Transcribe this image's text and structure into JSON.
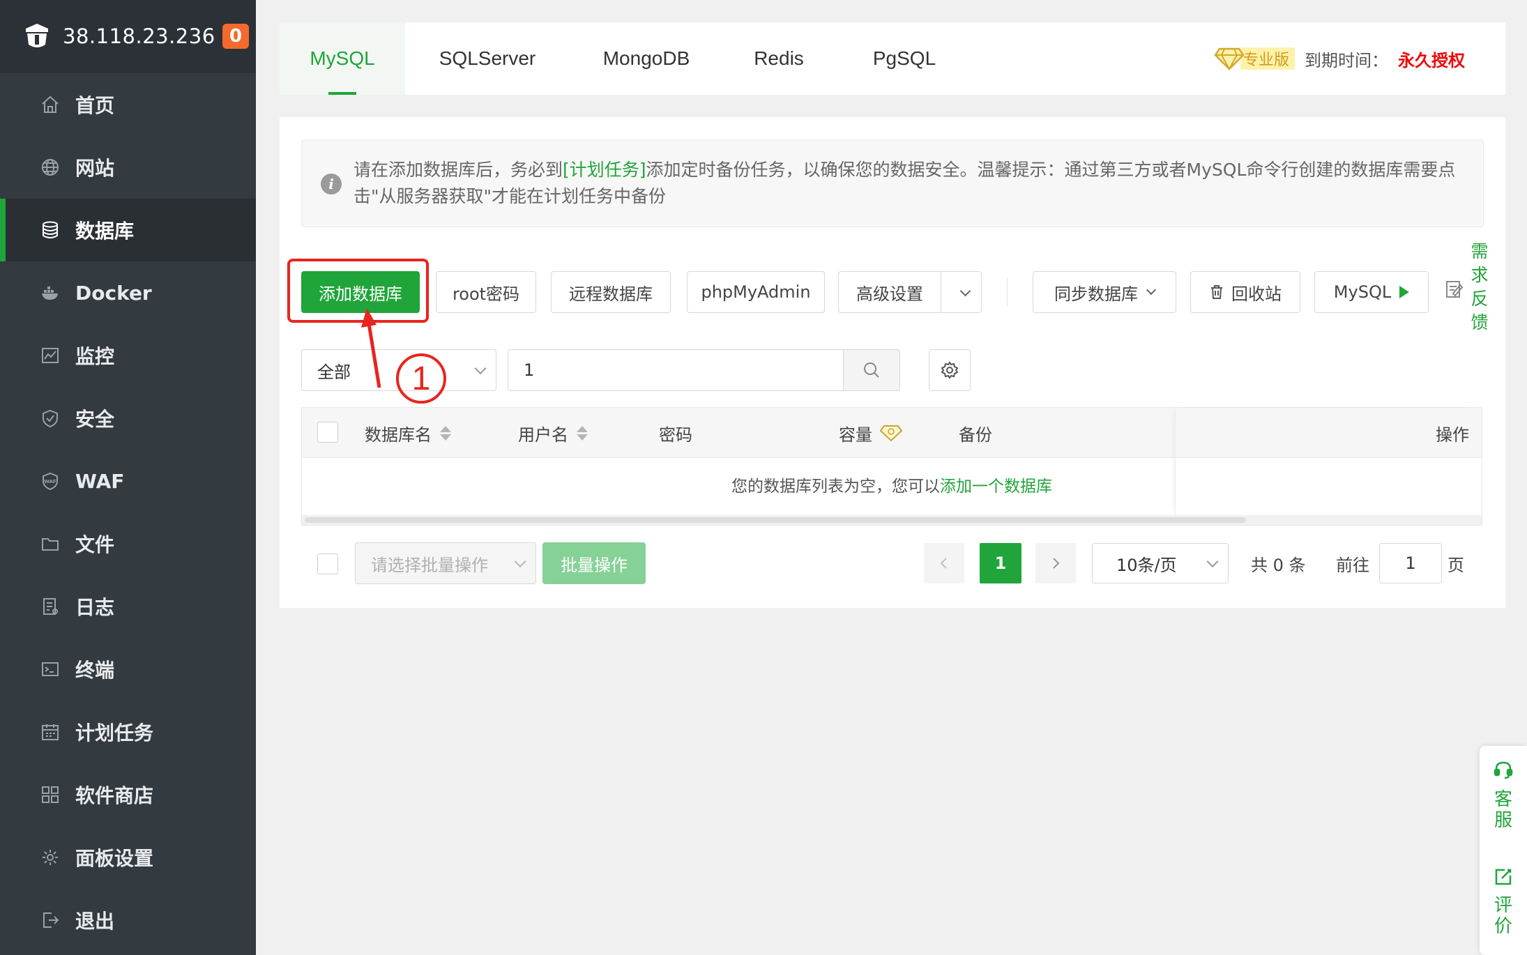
{
  "sidebar": {
    "server_ip": "38.118.23.236",
    "badge_count": "0",
    "items": [
      {
        "label": "首页",
        "icon": "home-icon"
      },
      {
        "label": "网站",
        "icon": "globe-icon"
      },
      {
        "label": "数据库",
        "icon": "database-icon",
        "active": true
      },
      {
        "label": "Docker",
        "icon": "docker-icon"
      },
      {
        "label": "监控",
        "icon": "monitor-icon"
      },
      {
        "label": "安全",
        "icon": "shield-icon"
      },
      {
        "label": "WAF",
        "icon": "waf-shield-icon"
      },
      {
        "label": "文件",
        "icon": "folder-icon"
      },
      {
        "label": "日志",
        "icon": "log-icon"
      },
      {
        "label": "终端",
        "icon": "terminal-icon"
      },
      {
        "label": "计划任务",
        "icon": "calendar-icon"
      },
      {
        "label": "软件商店",
        "icon": "apps-grid-icon"
      },
      {
        "label": "面板设置",
        "icon": "gear-icon"
      },
      {
        "label": "退出",
        "icon": "logout-icon"
      }
    ]
  },
  "tabs": {
    "items": [
      "MySQL",
      "SQLServer",
      "MongoDB",
      "Redis",
      "PgSQL"
    ],
    "active": "MySQL",
    "pro_label": "专业版",
    "expire_label": "到期时间：",
    "expire_value": "永久授权"
  },
  "notice": {
    "text_before": "请在添加数据库后，务必到",
    "link": "[计划任务]",
    "text_after": "添加定时备份任务，以确保您的数据安全。温馨提示：通过第三方或者MySQL命令行创建的数据库需要点击\"从服务器获取\"才能在计划任务中备份"
  },
  "toolbar": {
    "add_db": "添加数据库",
    "root_pwd": "root密码",
    "remote_db": "远程数据库",
    "phpmyadmin": "phpMyAdmin",
    "advanced": "高级设置",
    "sync_db": "同步数据库",
    "recycle": "回收站",
    "mysql": "MySQL",
    "feedback": [
      "需",
      "求",
      "反",
      "馈"
    ]
  },
  "filter": {
    "category_value": "全部",
    "search_value": "1"
  },
  "table": {
    "headers": {
      "name": "数据库名",
      "user": "用户名",
      "password": "密码",
      "capacity": "容量",
      "backup": "备份",
      "actions": "操作"
    },
    "empty_text": "您的数据库列表为空，您可以",
    "empty_link": "添加一个数据库"
  },
  "footer": {
    "batch_placeholder": "请选择批量操作",
    "batch_button": "批量操作",
    "current_page": "1",
    "page_size": "10条/页",
    "total": "共 0 条",
    "goto_label": "前往",
    "goto_value": "1",
    "page_suffix": "页"
  },
  "float_tools": {
    "service": [
      "客",
      "服"
    ],
    "review": [
      "评",
      "价"
    ]
  },
  "annotation": {
    "marker": "1"
  },
  "colors": {
    "accent": "#20a53a",
    "sidebar_bg": "#333a40",
    "highlight": "#e8251e",
    "badge": "#f36a2c"
  }
}
